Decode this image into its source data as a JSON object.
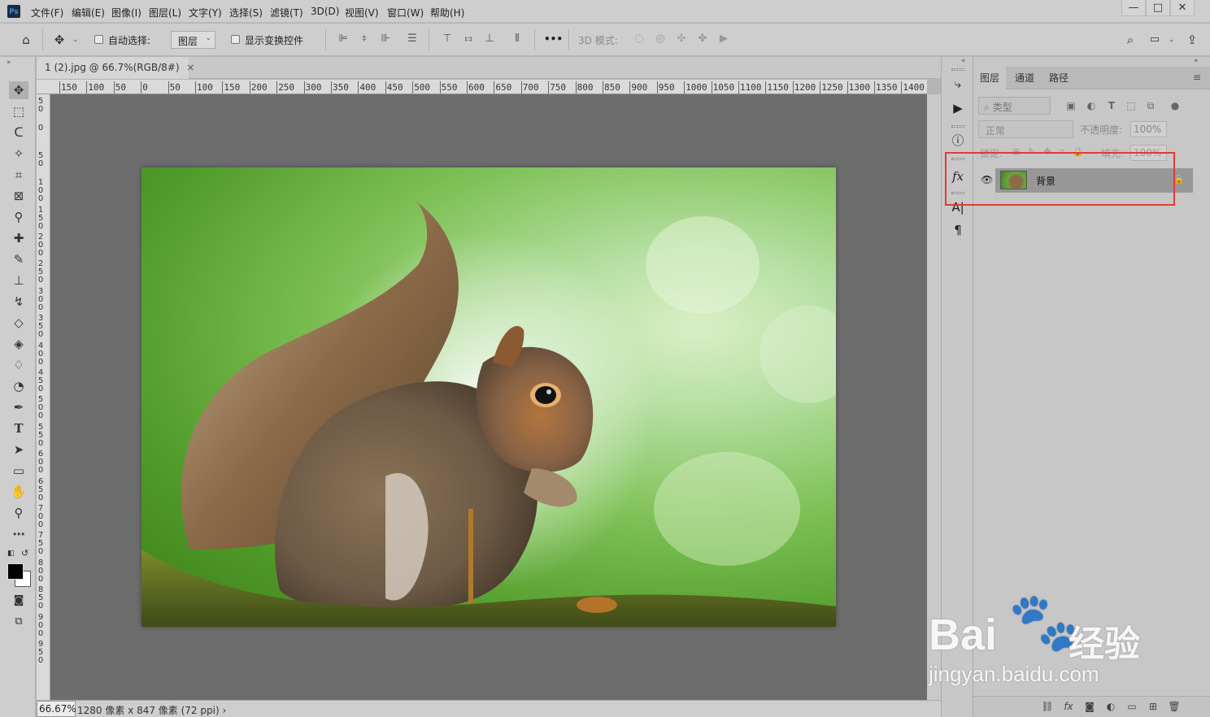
{
  "menubar": {
    "logo": "Ps",
    "items": [
      "文件(F)",
      "编辑(E)",
      "图像(I)",
      "图层(L)",
      "文字(Y)",
      "选择(S)",
      "滤镜(T)",
      "3D(D)",
      "视图(V)",
      "窗口(W)",
      "帮助(H)"
    ],
    "window_controls": {
      "minimize": "—",
      "restore": "□",
      "close": "✕"
    }
  },
  "options": {
    "auto_select_label": "自动选择:",
    "auto_select_value": "图层",
    "show_transform_label": "显示变换控件",
    "more": "•••",
    "mode_3d_label": "3D 模式:"
  },
  "document": {
    "tab_title": "1 (2).jpg @ 66.7%(RGB/8#)",
    "tab_close": "×",
    "zoom": "66.67%",
    "info": "1280 像素 x 847 像素 (72 ppi)",
    "info_arrow": "›"
  },
  "ruler": {
    "h_ticks": [
      "150",
      "100",
      "50",
      "0",
      "50",
      "100",
      "150",
      "200",
      "250",
      "300",
      "350",
      "400",
      "450",
      "500",
      "550",
      "600",
      "650",
      "700",
      "750",
      "800",
      "850",
      "900",
      "950",
      "1000",
      "1050",
      "1100",
      "1150",
      "1200",
      "1250",
      "1300",
      "1350",
      "1400"
    ],
    "v_ticks": [
      "5 0",
      "0",
      "5 0",
      "1 0 0",
      "1 5 0",
      "2 0 0",
      "2 5 0",
      "3 0 0",
      "3 5 0",
      "4 0 0",
      "4 5 0",
      "5 0 0",
      "5 5 0",
      "6 0 0",
      "6 5 0",
      "7 0 0",
      "7 5 0",
      "8 0 0",
      "8 5 0",
      "9 0 0",
      "9 5 0"
    ]
  },
  "layers_panel": {
    "tabs": [
      "图层",
      "通道",
      "路径"
    ],
    "filter_kind": "类型",
    "blend_mode": "正常",
    "opacity_label": "不透明度:",
    "opacity_value": "100%",
    "lock_label": "锁定:",
    "fill_label": "填充:",
    "fill_value": "100%",
    "layers": [
      {
        "name": "背景",
        "visible": true,
        "locked": true
      }
    ]
  },
  "watermark": {
    "brand": "Bai",
    "brand_cn": "经验",
    "url": "jingyan.baidu.com"
  },
  "colors": {
    "highlight": "#e53935",
    "ui_gray": "#cecece",
    "canvas": "#6d6d6d"
  }
}
